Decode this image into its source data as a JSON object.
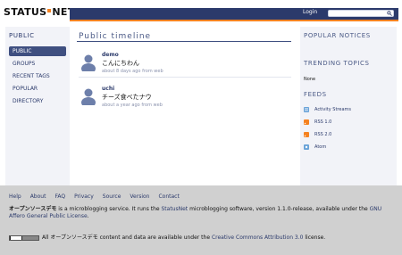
{
  "header": {
    "logo": {
      "text_left": "STATUS",
      "text_right": "NET"
    },
    "login_label": "Login",
    "search_placeholder": ""
  },
  "sidebar": {
    "title": "PUBLIC",
    "items": [
      {
        "label": "PUBLIC",
        "active": true
      },
      {
        "label": "GROUPS",
        "active": false
      },
      {
        "label": "RECENT TAGS",
        "active": false
      },
      {
        "label": "POPULAR",
        "active": false
      },
      {
        "label": "DIRECTORY",
        "active": false
      }
    ]
  },
  "main": {
    "title": "Public timeline",
    "notices": [
      {
        "user": "demo",
        "text": "こんにちわん",
        "time": "about 8 days ago",
        "source": "from web"
      },
      {
        "user": "uchi",
        "text": "チーズ食べたナウ",
        "time": "about a year ago",
        "source": "from web"
      }
    ]
  },
  "right": {
    "popular_notices_title": "POPULAR NOTICES",
    "trending_topics_title": "TRENDING TOPICS",
    "trending_none": "None",
    "feeds_title": "FEEDS",
    "feeds": [
      {
        "label": "Activity Streams",
        "icon": "activity-streams-icon"
      },
      {
        "label": "RSS 1.0",
        "icon": "rss-icon"
      },
      {
        "label": "RSS 2.0",
        "icon": "rss-icon"
      },
      {
        "label": "Atom",
        "icon": "atom-icon"
      }
    ]
  },
  "footer": {
    "links": [
      "Help",
      "About",
      "FAQ",
      "Privacy",
      "Source",
      "Version",
      "Contact"
    ],
    "about": {
      "site_name": "オープンソースデモ",
      "text1": " is a microblogging service. It runs the ",
      "statusnet_link": "StatusNet",
      "text2": " microblogging software, version 1.1.0-release, available under the ",
      "gnu_link": "GNU Affero General Public License",
      "text3": "."
    },
    "license": {
      "text1": "All オープンソースデモ content and data are available under the ",
      "cc_link": "Creative Commons Attribution 3.0",
      "text2": " license."
    }
  },
  "colors": {
    "topbar": "#2b3a6b",
    "accent": "#f58220",
    "sidebar_bg": "#f2f3f8",
    "footer_bg": "#d0d0d0"
  }
}
